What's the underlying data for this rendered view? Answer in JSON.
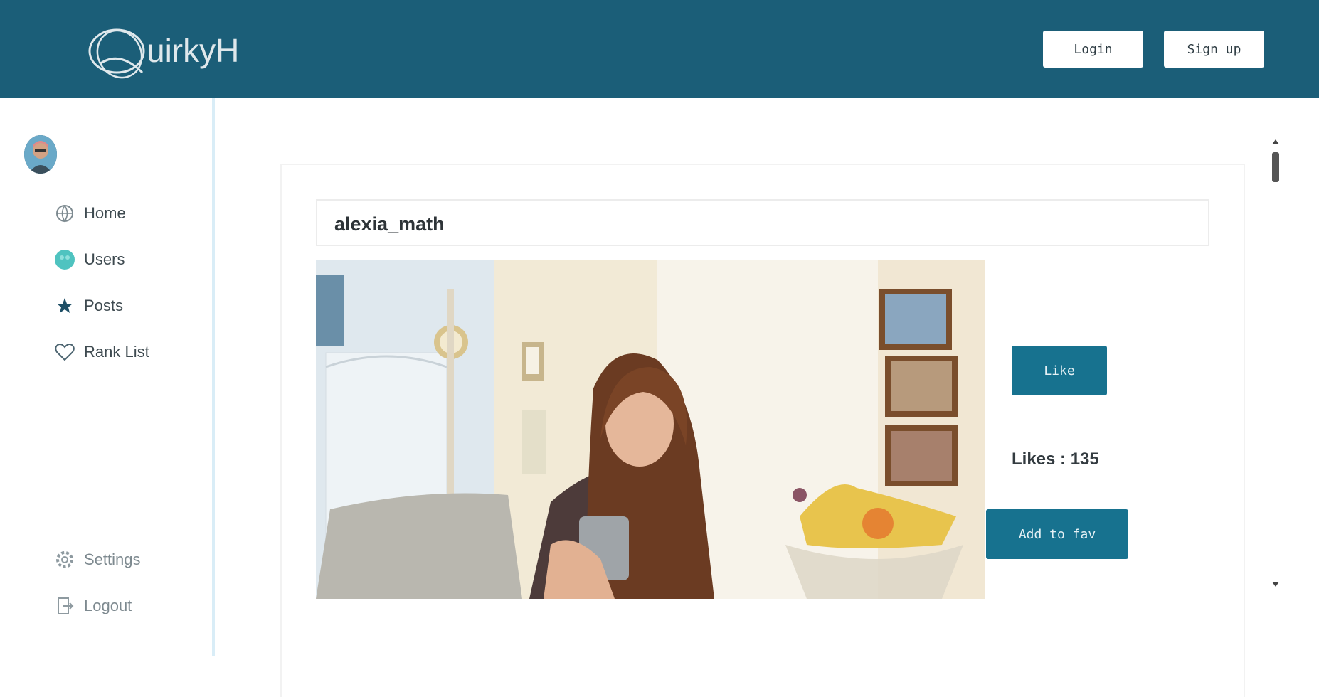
{
  "header": {
    "logo_text": "uirkyH",
    "login_label": "Login",
    "signup_label": "Sign up",
    "bg_color": "#1b5e78"
  },
  "sidebar": {
    "items": [
      {
        "label": "Home",
        "icon": "globe-icon"
      },
      {
        "label": "Users",
        "icon": "users-icon"
      },
      {
        "label": "Posts",
        "icon": "star-icon"
      },
      {
        "label": "Rank List",
        "icon": "heart-icon"
      }
    ],
    "bottom_items": [
      {
        "label": "Settings",
        "icon": "gear-icon"
      },
      {
        "label": "Logout",
        "icon": "logout-icon"
      }
    ]
  },
  "post": {
    "username": "alexia_math",
    "like_label": "Like",
    "likes_text": "Likes : 135",
    "fav_label": "Add to fav",
    "image_icon": "photo-woman-with-phone",
    "accent_color": "#17728f"
  }
}
